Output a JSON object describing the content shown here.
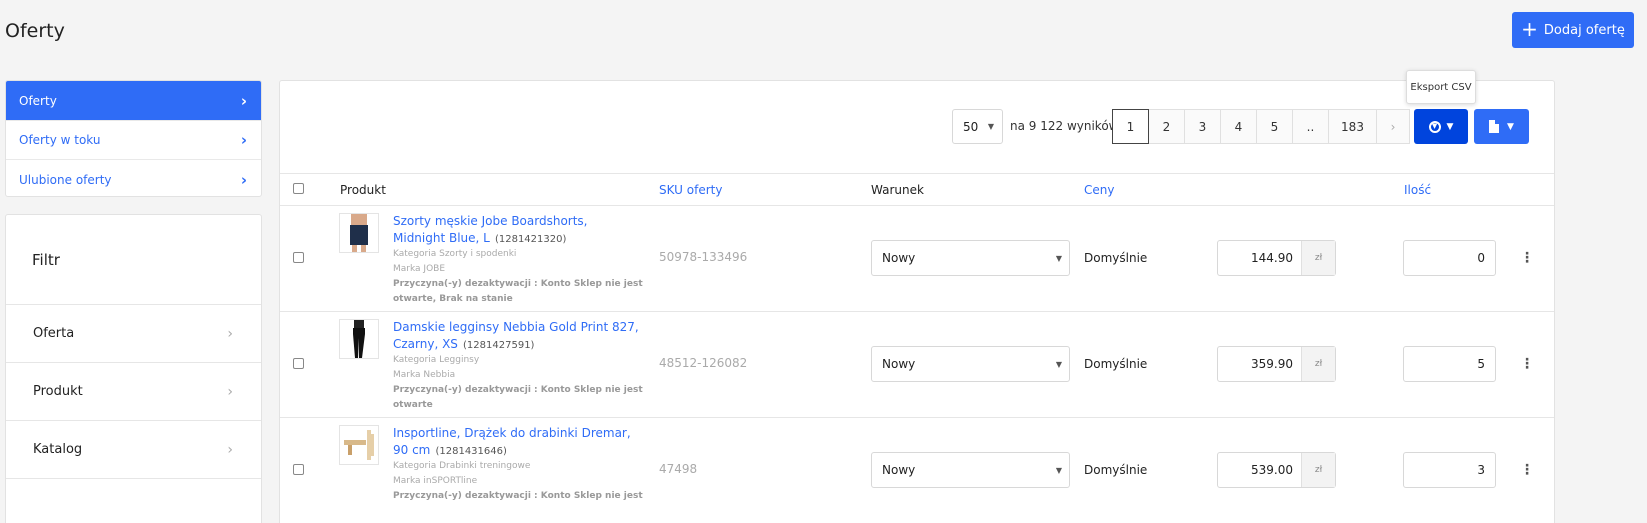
{
  "page": {
    "title": "Oferty",
    "add_button_label": "Dodaj ofertę",
    "add_icon": "plus-icon"
  },
  "nav": {
    "items": [
      {
        "label": "Oferty",
        "active": true
      },
      {
        "label": "Oferty w toku",
        "active": false
      },
      {
        "label": "Ulubione oferty",
        "active": false
      }
    ]
  },
  "filters": {
    "title": "Filtr",
    "items": [
      "Oferta",
      "Produkt",
      "Katalog"
    ]
  },
  "toolbar": {
    "per_page": "50",
    "results_text": "na 9 122 wyników",
    "pages": [
      "1",
      "2",
      "3",
      "4",
      "5",
      "..",
      "183"
    ],
    "next_symbol": "›",
    "export_tooltip": "Eksport CSV"
  },
  "table": {
    "headers": {
      "product": "Produkt",
      "sku": "SKU oferty",
      "condition": "Warunek",
      "prices": "Ceny",
      "quantity": "Ilość"
    },
    "rows": [
      {
        "name": "Szorty męskie Jobe Boardshorts, Midnight Blue, L",
        "id": "(1281421320)",
        "category": "Kategoria Szorty i spodenki",
        "brand": "Marka JOBE",
        "reason": "Przyczyna(-y) dezaktywacji : Konto Sklep nie jest otwarte, Brak na stanie",
        "sku": "50978-133496",
        "condition": "Nowy",
        "price_type": "Domyślnie",
        "price": "144.90",
        "currency": "zł",
        "quantity": "0"
      },
      {
        "name": "Damskie legginsy Nebbia Gold Print 827, Czarny, XS",
        "id": "(1281427591)",
        "category": "Kategoria Legginsy",
        "brand": "Marka Nebbia",
        "reason": "Przyczyna(-y) dezaktywacji : Konto Sklep nie jest otwarte",
        "sku": "48512-126082",
        "condition": "Nowy",
        "price_type": "Domyślnie",
        "price": "359.90",
        "currency": "zł",
        "quantity": "5"
      },
      {
        "name": "Insportline, Drążek do drabinki Dremar, 90 cm",
        "id": "(1281431646)",
        "category": "Kategoria Drabinki treningowe",
        "brand": "Marka inSPORTline",
        "reason": "Przyczyna(-y) dezaktywacji : Konto Sklep nie jest",
        "sku": "47498",
        "condition": "Nowy",
        "price_type": "Domyślnie",
        "price": "539.00",
        "currency": "zł",
        "quantity": "3"
      }
    ]
  },
  "colors": {
    "accent": "#2f6cf6",
    "export_button": "#0044dd"
  }
}
